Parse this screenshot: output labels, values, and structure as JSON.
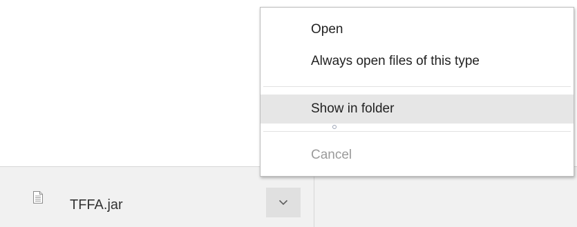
{
  "download_shelf": {
    "file_name": "TFFA.jar",
    "file_icon": "document-icon",
    "menu_button_icon": "chevron-down-icon"
  },
  "context_menu": {
    "items": [
      {
        "label": "Open",
        "state": "normal"
      },
      {
        "label": "Always open files of this type",
        "state": "normal"
      },
      {
        "label": "Show in folder",
        "state": "highlighted"
      },
      {
        "label": "Cancel",
        "state": "disabled"
      }
    ]
  },
  "colors": {
    "shelf_background": "#f1f1f1",
    "menu_highlight": "#e6e6e6",
    "disabled_text": "#9a9a9a"
  }
}
